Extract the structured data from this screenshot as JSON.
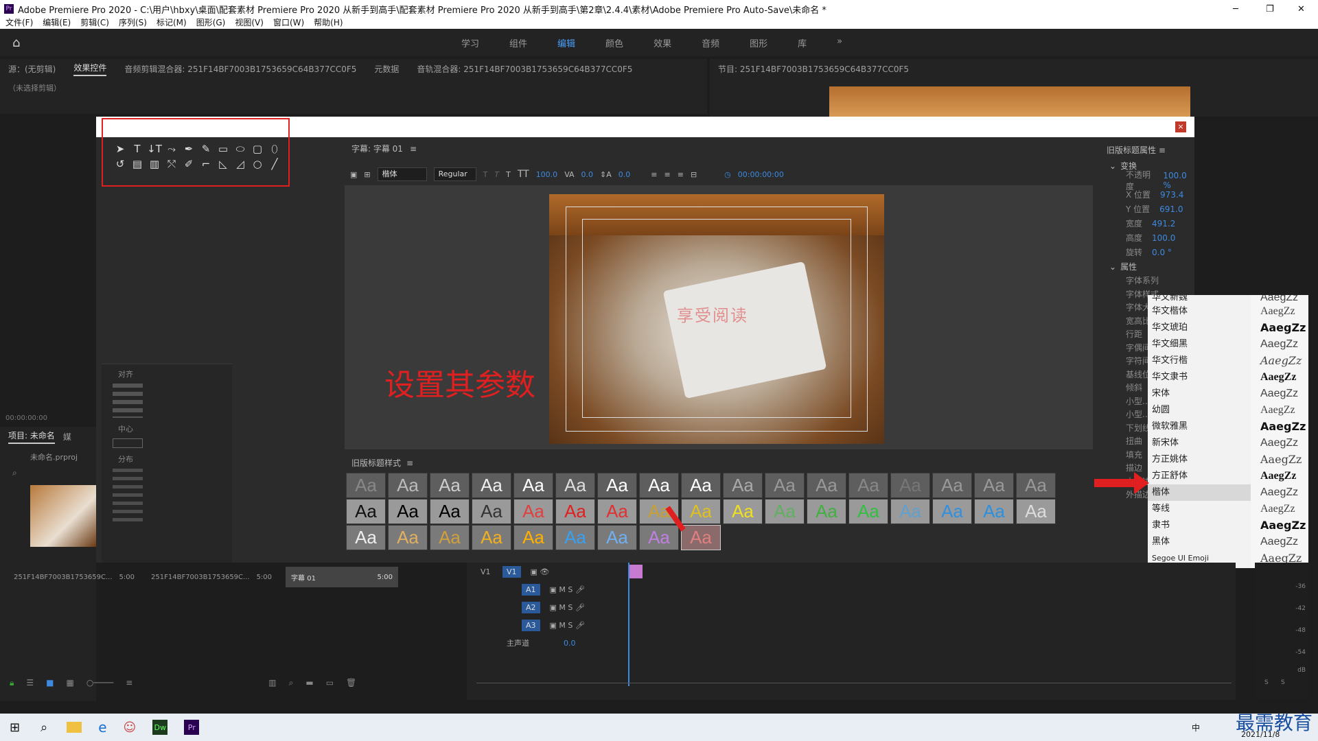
{
  "window": {
    "title": "Adobe Premiere Pro 2020 - C:\\用户\\hbxy\\桌面\\配套素材 Premiere Pro 2020 从新手到高手\\配套素材 Premiere Pro 2020 从新手到高手\\第2章\\2.4.4\\素材\\Adobe Premiere Pro Auto-Save\\未命名 *",
    "controls": [
      "─",
      "❐",
      "✕"
    ]
  },
  "menu": [
    "文件(F)",
    "编辑(E)",
    "剪辑(C)",
    "序列(S)",
    "标记(M)",
    "图形(G)",
    "视图(V)",
    "窗口(W)",
    "帮助(H)"
  ],
  "workspaces": [
    "学习",
    "组件",
    "编辑",
    "颜色",
    "效果",
    "音频",
    "图形",
    "库",
    "»"
  ],
  "source_panel": {
    "tabs": [
      "源：(无剪辑)",
      "效果控件",
      "音频剪辑混合器: 251F14BF7003B1753659C64B377CC0F5",
      "元数据",
      "音轨混合器: 251F14BF7003B1753659C64B377CC0F5"
    ],
    "no_clip": "（未选择剪辑）",
    "timecode": "00:00:00:00"
  },
  "program_panel": {
    "title": "节目: 251F14BF7003B1753659C64B377CC0F5"
  },
  "title_panel": {
    "name": "字幕: 字幕 01",
    "font": "楷体",
    "style": "Regular",
    "size": "100.0",
    "kerning": "0.0",
    "leading": "0.0",
    "timecode": "00:00:00:00"
  },
  "align_panel": {
    "align": "对齐",
    "center": "中心",
    "distribute": "分布"
  },
  "canvas": {
    "overlay_text": "享受阅读"
  },
  "annotation": "设置其参数",
  "styles_panel": {
    "title": "旧版标题样式",
    "sample": "Aa"
  },
  "props_panel": {
    "title": "旧版标题属性",
    "transform": "变换",
    "props": [
      {
        "label": "不透明度",
        "value": "100.0 %"
      },
      {
        "label": "X 位置",
        "value": "973.4"
      },
      {
        "label": "Y 位置",
        "value": "691.0"
      },
      {
        "label": "宽度",
        "value": "491.2"
      },
      {
        "label": "高度",
        "value": "100.0"
      },
      {
        "label": "旋转",
        "value": "0.0 °"
      }
    ],
    "attributes": "属性",
    "attr_labels": [
      "字体系列",
      "字体样式",
      "字体大小",
      "宽高比",
      "行距",
      "字偶间距",
      "字符间距",
      "基线位移",
      "倾斜",
      "小型...",
      "小型...",
      "下划线",
      "扭曲",
      "填充",
      "描边",
      "内描边",
      "外描边"
    ]
  },
  "font_dropdown": {
    "items": [
      "华文新魏",
      "华文楷体",
      "华文琥珀",
      "华文细黑",
      "华文行楷",
      "华文隶书",
      "宋体",
      "幼圆",
      "微软雅黑",
      "新宋体",
      "方正姚体",
      "方正舒体",
      "楷体",
      "等线",
      "隶书",
      "黑体",
      "Segoe UI Emoji"
    ],
    "selected": "楷体",
    "preview": "AaegZz"
  },
  "project_panel": {
    "title": "项目: 未命名",
    "tab2": "媒",
    "file": "未命名.prproj",
    "clips": [
      {
        "name": "251F14BF7003B1753659C...",
        "dur": "5:00"
      },
      {
        "name": "251F14BF7003B1753659C...",
        "dur": "5:00"
      },
      {
        "name": "字幕 01",
        "dur": "5:00"
      }
    ]
  },
  "timeline": {
    "tracks": [
      "V1",
      "A1",
      "A2",
      "A3"
    ],
    "master": "主声道",
    "master_val": "0.0",
    "meter": [
      "-36",
      "-42",
      "-48",
      "-54",
      "dB"
    ],
    "solo": [
      "S",
      "S"
    ]
  },
  "taskbar": {
    "date": "2021/11/8",
    "ime": "中",
    "watermark": "最需教育"
  }
}
